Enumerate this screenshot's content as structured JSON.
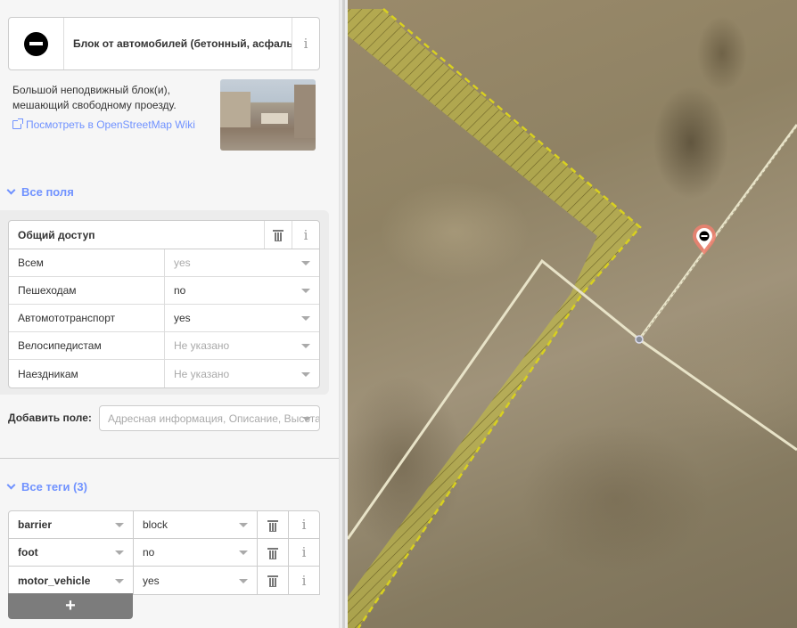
{
  "preset": {
    "name": "Блок от автомобилей (бетонный, асфальтовый, каменный)",
    "description": "Большой неподвижный блок(и), мешающий свободному проезду.",
    "wiki_link": "Посмотреть в OpenStreetMap Wiki"
  },
  "fields_section": {
    "title": "Все поля"
  },
  "access": {
    "title": "Общий доступ",
    "rows": [
      {
        "label": "Всем",
        "value": "yes",
        "muted": true
      },
      {
        "label": "Пешеходам",
        "value": "no",
        "muted": false
      },
      {
        "label": "Автомототранспорт",
        "value": "yes",
        "muted": false
      },
      {
        "label": "Велосипедистам",
        "value": "Не указано",
        "muted": true
      },
      {
        "label": "Наездникам",
        "value": "Не указано",
        "muted": true
      }
    ]
  },
  "add_field": {
    "label": "Добавить поле:",
    "placeholder": "Адресная информация, Описание, Высота, Материал, Название"
  },
  "tags_section": {
    "title": "Все теги (3)"
  },
  "tags": [
    {
      "key": "barrier",
      "value": "block"
    },
    {
      "key": "foot",
      "value": "no"
    },
    {
      "key": "motor_vehicle",
      "value": "yes"
    }
  ],
  "add_tag_label": "+",
  "icons": {
    "preset": "no-entry-icon",
    "info": "info-icon",
    "delete": "trash-icon",
    "expand": "chevron-down-icon",
    "external": "external-link-icon",
    "map_pin": "barrier-pin-icon"
  },
  "colors": {
    "accent": "#7092ff",
    "hatched_area": "#c8c23c",
    "selected_pin": "#f08070",
    "road": "#e8e3c8"
  }
}
